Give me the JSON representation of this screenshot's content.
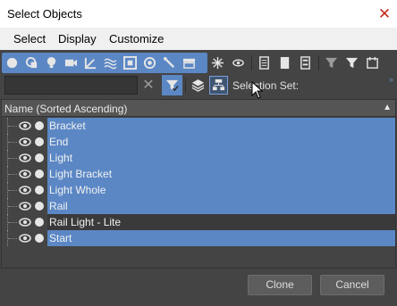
{
  "window": {
    "title": "Select Objects",
    "close_glyph": "✕"
  },
  "menu": [
    "Select",
    "Display",
    "Customize"
  ],
  "toolbar": {
    "icons": [
      "geometry-filter-icon",
      "shapes-filter-icon",
      "lights-filter-icon",
      "cameras-filter-icon",
      "helpers-filter-icon",
      "spacewarps-filter-icon",
      "group-filter-icon",
      "xref-filter-icon",
      "bone-filter-icon",
      "container-filter-icon",
      "particle-filter-icon",
      "frozen-filter-icon",
      "hidden-filter-icon",
      "display-all-icon",
      "display-none-icon",
      "invert-display-icon",
      "filter-options-icon",
      "funnel-icon",
      "frame-icon"
    ],
    "accent_color": "#5b87c5"
  },
  "filter": {
    "value": "",
    "clear_glyph": "✕"
  },
  "selection_set_label": "Selection Set:",
  "expand_glyph": "»",
  "list": {
    "header": "Name (Sorted Ascending)",
    "sort_glyph": "▲",
    "items": [
      {
        "name": "Bracket",
        "selected": true
      },
      {
        "name": "End",
        "selected": true
      },
      {
        "name": "Light",
        "selected": true
      },
      {
        "name": "Light Bracket",
        "selected": true
      },
      {
        "name": "Light Whole",
        "selected": true
      },
      {
        "name": "Rail",
        "selected": true
      },
      {
        "name": "Rail Light - Lite",
        "selected": false
      },
      {
        "name": "Start",
        "selected": true
      }
    ]
  },
  "buttons": {
    "clone": "Clone",
    "cancel": "Cancel"
  }
}
